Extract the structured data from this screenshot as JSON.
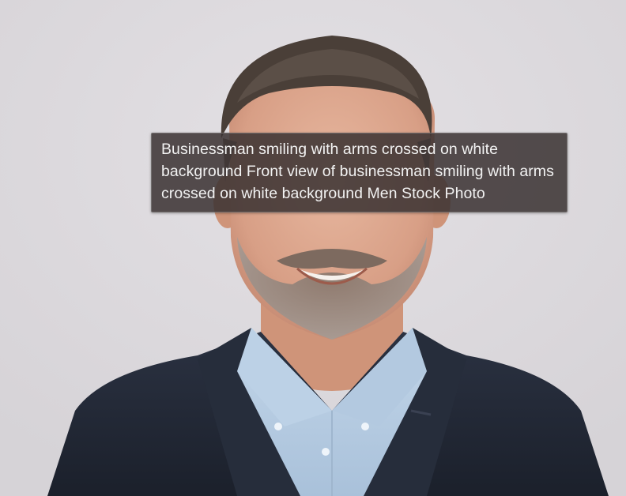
{
  "image": {
    "subject_icon": "photo-businessman",
    "colors": {
      "background": "#dcd9dd",
      "suit": "#232a38",
      "shirt": "#b7cde3",
      "tooltip_bg": "#3a3232"
    }
  },
  "tooltip": {
    "text": "Businessman smiling with arms crossed on white background Front view of businessman smiling with arms crossed on white background Men Stock Photo"
  }
}
